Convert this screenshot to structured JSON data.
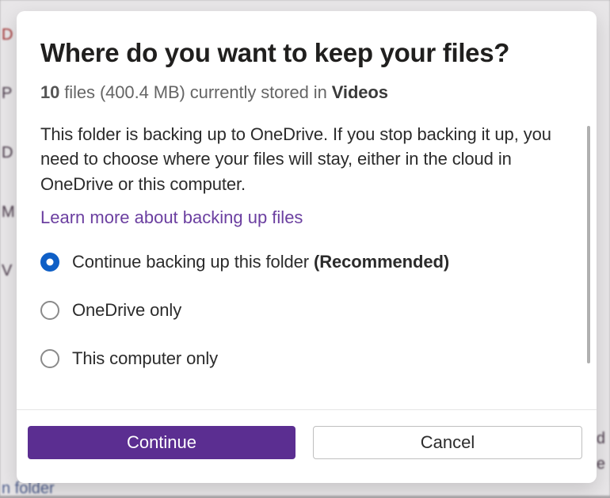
{
  "dialog": {
    "title": "Where do you want to keep your files?",
    "summary": {
      "file_count": "10",
      "files_word": "files",
      "size": "(400.4 MB)",
      "stored_text": "currently stored in",
      "folder_name": "Videos"
    },
    "description": "This folder is backing up to OneDrive. If you stop backing it up, you need to choose where your files will stay, either in the cloud in OneDrive or this computer.",
    "learn_more": "Learn more about backing up files",
    "options": {
      "continue_backup": {
        "label": "Continue backing up this folder",
        "suffix": "(Recommended)"
      },
      "onedrive_only": {
        "label": "OneDrive only"
      },
      "computer_only": {
        "label": "This computer only"
      }
    },
    "buttons": {
      "continue": "Continue",
      "cancel": "Cancel"
    }
  },
  "backdrop_letters": {
    "l0": "D",
    "l1": "P",
    "l2": "D",
    "l3": "M",
    "l4": "V",
    "l5": "d",
    "l6": "e",
    "l7": "n folder"
  }
}
